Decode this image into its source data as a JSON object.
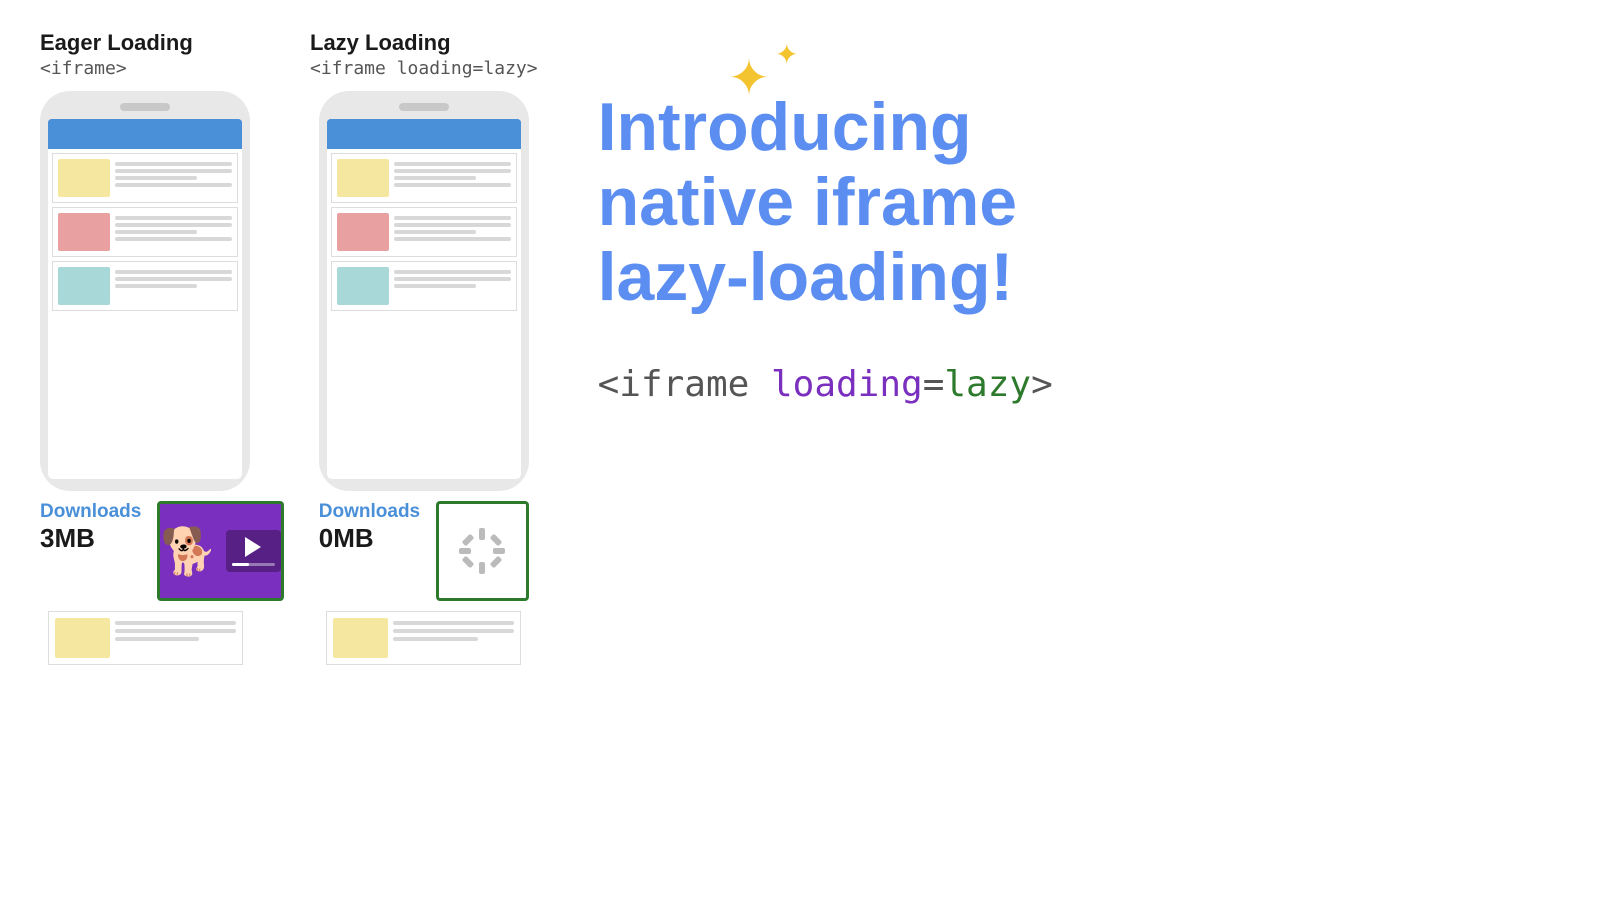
{
  "eager": {
    "title": "Eager Loading",
    "code": "<iframe>",
    "downloads_label": "Downloads",
    "downloads_value": "3MB"
  },
  "lazy": {
    "title": "Lazy Loading",
    "code": "<iframe loading=lazy>",
    "downloads_label": "Downloads",
    "downloads_value": "0MB"
  },
  "intro": {
    "heading_line1": "Introducing",
    "heading_line2": "native iframe",
    "heading_line3": "lazy-loading!"
  },
  "code_snippet": {
    "part1": "<iframe ",
    "part2": "loading",
    "part3": "=",
    "part4": "lazy",
    "part5": ">"
  }
}
